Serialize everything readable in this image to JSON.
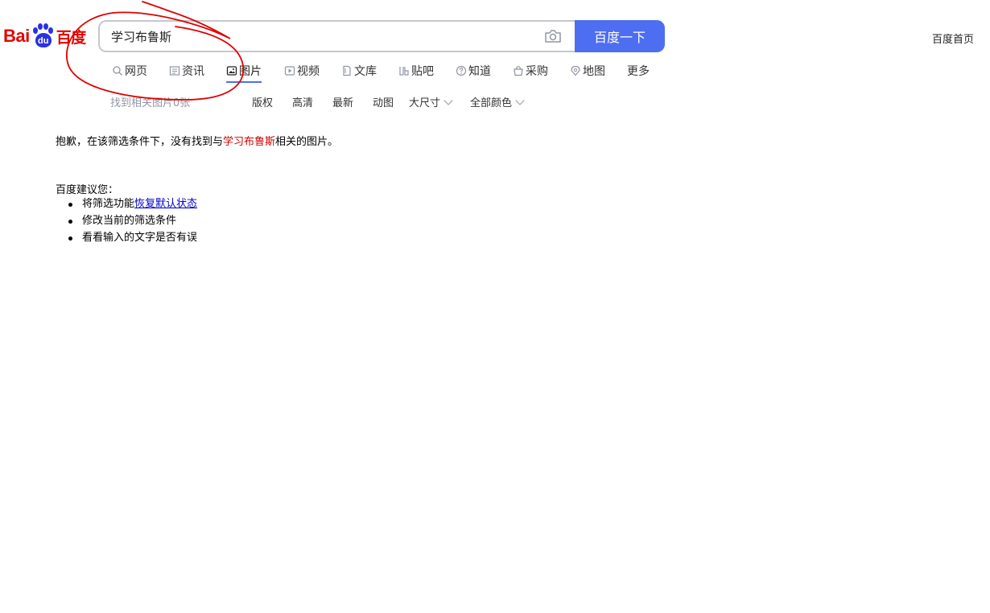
{
  "logo": {
    "text_left": "Bai",
    "text_paw": "du",
    "text_right": "百度"
  },
  "header": {
    "search_value": "学习布鲁斯",
    "search_button": "百度一下",
    "home_link": "百度首页"
  },
  "tabs": [
    {
      "label": "网页",
      "icon": "search-icon"
    },
    {
      "label": "资讯",
      "icon": "news-icon"
    },
    {
      "label": "图片",
      "icon": "image-icon",
      "active": true
    },
    {
      "label": "视频",
      "icon": "video-icon"
    },
    {
      "label": "文库",
      "icon": "document-icon"
    },
    {
      "label": "贴吧",
      "icon": "tieba-icon"
    },
    {
      "label": "知道",
      "icon": "question-icon"
    },
    {
      "label": "采购",
      "icon": "shopping-icon"
    },
    {
      "label": "地图",
      "icon": "map-icon"
    },
    {
      "label": "更多"
    }
  ],
  "filters": {
    "result_count": "找到相关图片0张",
    "copyright": "版权",
    "hd": "高清",
    "latest": "最新",
    "animated": "动图",
    "size": "大尺寸",
    "color": "全部颜色"
  },
  "main": {
    "sorry_prefix": "抱歉，在该筛选条件下，没有找到与",
    "keyword": "学习布鲁斯",
    "sorry_suffix": "相关的图片。",
    "suggest_title": "百度建议您：",
    "suggestions": {
      "item1_prefix": "将筛选功能",
      "item1_link": "恢复默认状态",
      "item2": "修改当前的筛选条件",
      "item3": "看看输入的文字是否有误"
    }
  },
  "colors": {
    "brand_blue": "#4e6ef2",
    "logo_red": "#e10601",
    "logo_blue": "#2932e1",
    "keyword_red": "#cc0000",
    "annotation_red": "#e00000"
  }
}
